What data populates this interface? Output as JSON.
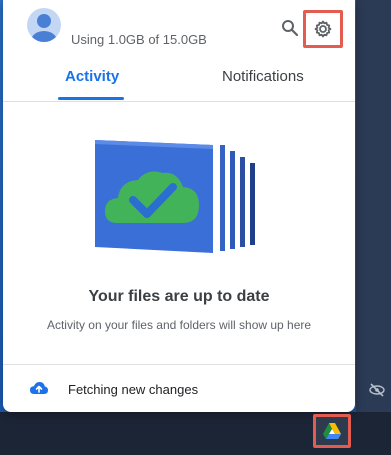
{
  "header": {
    "storage_text": "Using 1.0GB of 15.0GB",
    "avatar_icon": "user-avatar-icon",
    "search_icon": "search-icon",
    "settings_icon": "gear-icon"
  },
  "tabs": [
    {
      "label": "Activity",
      "selected": true
    },
    {
      "label": "Notifications",
      "selected": false
    }
  ],
  "empty_state": {
    "illustration": "cloud-check-stacked-folders",
    "title": "Your files are up to date",
    "subtitle": "Activity on your files and folders will show up here"
  },
  "footer": {
    "icon": "cloud-upload-icon",
    "status_text": "Fetching new changes"
  },
  "taskbar": {
    "tray_icon": "eye-slash-icon",
    "app_icon": "google-drive-icon"
  },
  "colors": {
    "accent": "#1a73e8",
    "highlight_box": "#e45c4f",
    "desktop": "#1f5fb8"
  }
}
